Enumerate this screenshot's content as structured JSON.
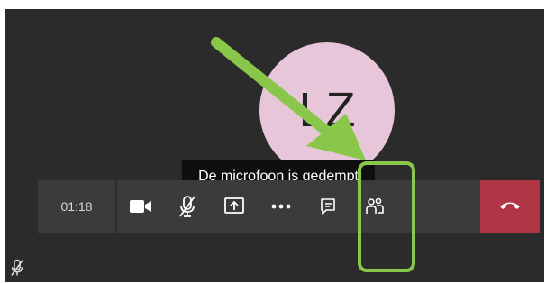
{
  "call": {
    "avatar_initials": "LZ",
    "mute_tooltip": "De microfoon is gedempt"
  },
  "toolbar": {
    "timer": "01:18",
    "buttons": [
      {
        "name": "video-camera-icon"
      },
      {
        "name": "microphone-muted-icon"
      },
      {
        "name": "share-screen-icon"
      },
      {
        "name": "more-options-icon"
      },
      {
        "name": "chat-icon"
      },
      {
        "name": "participants-icon"
      }
    ],
    "hangup": {
      "name": "phone-hangup-icon",
      "color": "#b03545"
    }
  },
  "annotation": {
    "highlight_color": "#89c74a",
    "target": "chat-button"
  },
  "colors": {
    "stage_background": "#2b2b2b",
    "toolbar_background": "#3b3b3b",
    "avatar_background": "#e8c6da"
  }
}
